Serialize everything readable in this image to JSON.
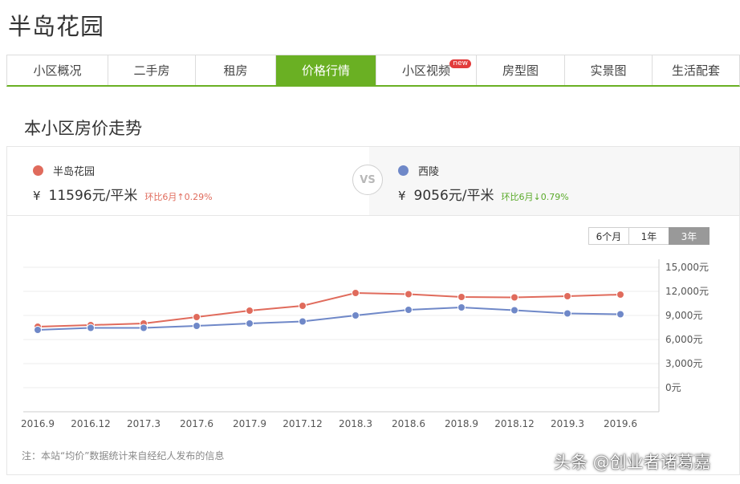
{
  "page": {
    "title": "半岛花园"
  },
  "tabs": [
    {
      "label": "小区概况"
    },
    {
      "label": "二手房"
    },
    {
      "label": "租房"
    },
    {
      "label": "价格行情",
      "active": true
    },
    {
      "label": "小区视频",
      "badge": "new"
    },
    {
      "label": "房型图"
    },
    {
      "label": "实景图"
    },
    {
      "label": "生活配套"
    }
  ],
  "section": {
    "title": "本小区房价走势"
  },
  "compare": {
    "left": {
      "name": "半岛花园",
      "currency": "¥",
      "price": "11596元/平米",
      "change": "环比6月↑0.29%",
      "color": "#e06b5c",
      "change_color": "#e06b5c"
    },
    "vs": "VS",
    "right": {
      "name": "西陵",
      "currency": "¥",
      "price": "9056元/平米",
      "change": "环比6月↓0.79%",
      "color": "#6f88c8",
      "change_color": "#5aaa2a"
    }
  },
  "range_buttons": [
    {
      "label": "6个月"
    },
    {
      "label": "1年"
    },
    {
      "label": "3年",
      "active": true
    }
  ],
  "chart_data": {
    "type": "line",
    "x": [
      "2016.9",
      "2016.12",
      "2017.3",
      "2017.6",
      "2017.9",
      "2017.12",
      "2018.3",
      "2018.6",
      "2018.9",
      "2018.12",
      "2019.3",
      "2019.6"
    ],
    "series": [
      {
        "name": "半岛花园",
        "color": "#e06b5c",
        "values": [
          7600,
          7800,
          8000,
          8800,
          9600,
          10200,
          11800,
          11650,
          11300,
          11250,
          11400,
          11600
        ]
      },
      {
        "name": "西陵",
        "color": "#6f88c8",
        "values": [
          7200,
          7450,
          7450,
          7700,
          8000,
          8250,
          9000,
          9700,
          10000,
          9650,
          9250,
          9150
        ]
      }
    ],
    "ylim": [
      -3000,
      15000
    ],
    "yticks": [
      0,
      3000,
      6000,
      9000,
      12000,
      15000
    ],
    "ytick_labels": [
      "0元",
      "3,000元",
      "6,000元",
      "9,000元",
      "12,000元",
      "15,000元"
    ],
    "grid": true,
    "y_axis_position": "right"
  },
  "footnote": "注：本站“均价”数据统计来自经纪人发布的信息",
  "watermark": "头条 @创业者诸葛嘉"
}
